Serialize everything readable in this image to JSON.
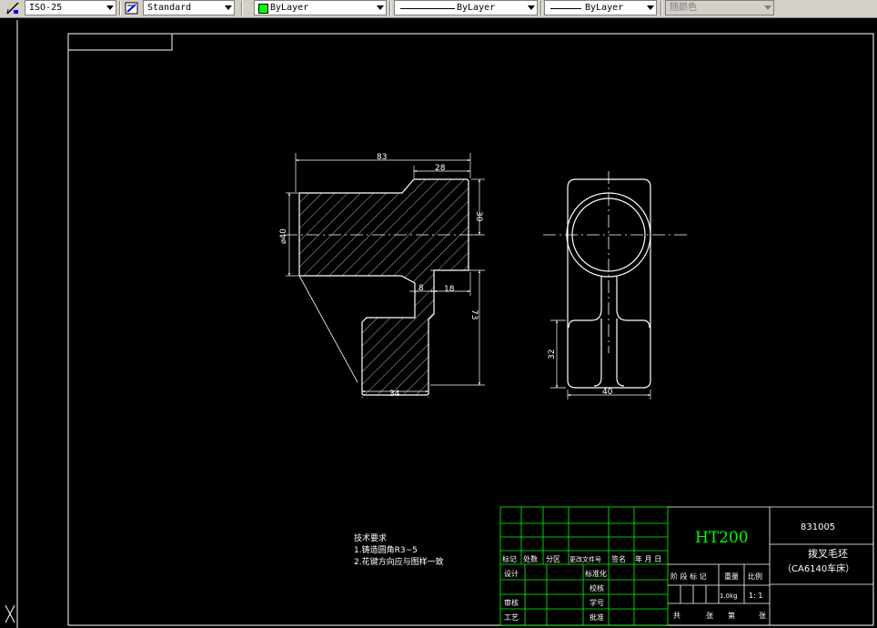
{
  "toolbar": {
    "dimstyle": "ISO-25",
    "textstyle": "Standard",
    "color": "ByLayer",
    "linetype": "ByLayer",
    "lineweight": "ByLayer",
    "plotstyle": "随颜色",
    "color_swatch": "#00ff00"
  },
  "drawing": {
    "dims": {
      "d83": "83",
      "d28": "28",
      "d30": "30",
      "d40dia": "⌀40",
      "d8": "8",
      "d18": "18",
      "d73": "73",
      "d34": "34",
      "d32": "32",
      "d40": "40"
    }
  },
  "notes": {
    "title": "技术要求",
    "line1": "1.铸造圆角R3~5",
    "line2": "2.花键方向应与图样一致"
  },
  "title_block": {
    "material": "HT200",
    "drawing_no": "831005",
    "part_name": "拨叉毛坯",
    "machine": "（CA6140车床）",
    "headers": [
      "标记",
      "处数",
      "分区",
      "更改文件号",
      "签名",
      "年 月 日"
    ],
    "design": "设计",
    "standardize": "标准化",
    "verify": "校核",
    "check": "审核",
    "craft": "工艺",
    "seq": "学号",
    "approve": "批准",
    "stage_mark": "阶 段 标 记",
    "weight_label": "重量",
    "scale_label": "比例",
    "weight": "1.0kg",
    "scale": "1: 1",
    "total": "共",
    "sheets": "张",
    "page": "第",
    "sheet2": "张"
  }
}
